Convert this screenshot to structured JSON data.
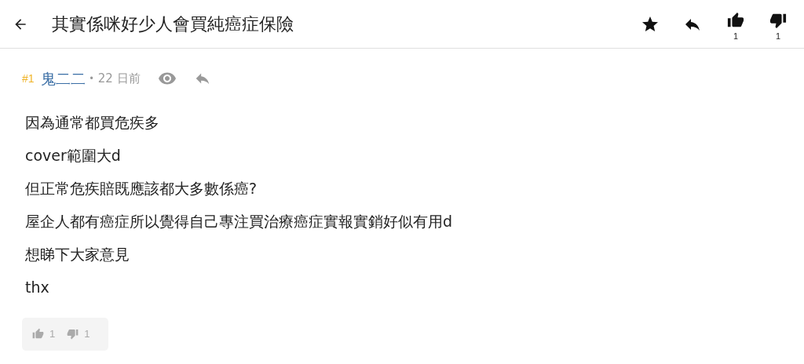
{
  "header": {
    "title": "其實係咪好少人會買純癌症保險",
    "upvotes": "1",
    "downvotes": "1"
  },
  "post": {
    "number": "#1",
    "author": "鬼二二",
    "separator": "•",
    "time": "22 日前",
    "lines": [
      "因為通常都買危疾多",
      "cover範圍大d",
      "但正常危疾賠既應該都大多數係癌?",
      "屋企人都有癌症所以覺得自己專注買治療癌症實報實銷好似有用d",
      "想睇下大家意見",
      "thx"
    ],
    "upvotes": "1",
    "downvotes": "1"
  }
}
